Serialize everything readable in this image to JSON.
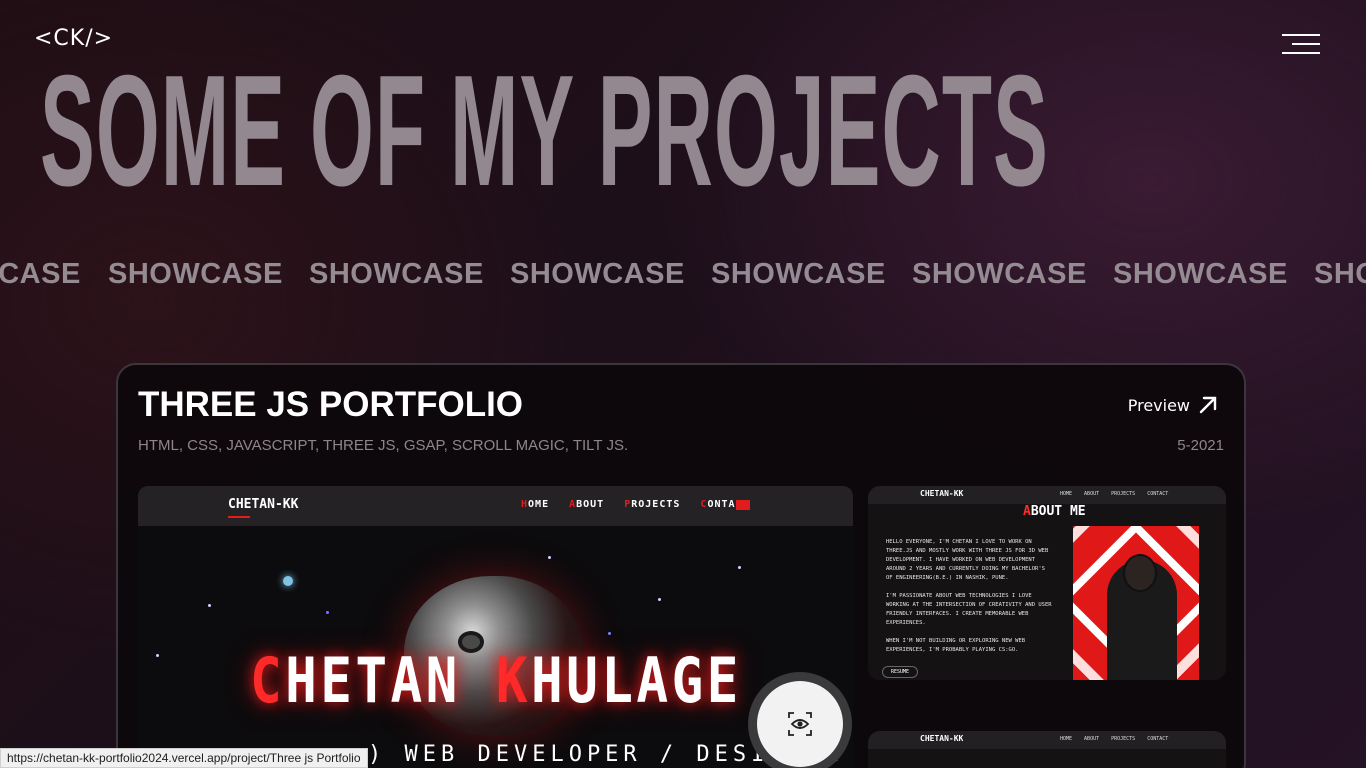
{
  "header": {
    "logo": "<CK/>",
    "menu_icon": "hamburger-menu-icon"
  },
  "hero": {
    "title": "SOME OF MY PROJECTS",
    "ticker_word": "SHOWCASE"
  },
  "project": {
    "title": "THREE JS PORTFOLIO",
    "preview_label": "Preview",
    "preview_icon": "arrow-up-right-icon",
    "tags": "HTML, CSS, JAVASCRIPT, THREE JS, GSAP, SCROLL MAGIC, TILT JS.",
    "date": "5-2021",
    "view_icon": "eye-focus-icon",
    "main_screenshot": {
      "brand": "CHETAN-KK",
      "nav": [
        "HOME",
        "ABOUT",
        "PROJECTS",
        "CONTACT"
      ],
      "name_first": "CHETAN",
      "name_last": "KHULAGE",
      "subtitle": ") WEB DEVELOPER / DESIGNER"
    },
    "side_screenshot": {
      "brand": "CHETAN-KK",
      "nav": [
        "HOME",
        "ABOUT",
        "PROJECTS",
        "CONTACT"
      ],
      "heading_first": "A",
      "heading_rest": "BOUT ME",
      "para1": "HELLO EVERYONE, I'M CHETAN I LOVE TO WORK ON THREE.JS AND MOSTLY WORK WITH THREE JS FOR 3D WEB DEVELOPMENT. I HAVE WORKED ON WEB DEVELOPMENT AROUND 2 YEARS AND CURRENTLY DOING MY BACHELOR'S OF ENGINEERING(B.E.) IN NASHIK, PUNE.",
      "para2": "I'M PASSIONATE ABOUT WEB TECHNOLOGIES I LOVE WORKING AT THE INTERSECTION OF CREATIVITY AND USER FRIENDLY INTERFACES. I CREATE MEMORABLE WEB EXPERIENCES.",
      "para3": "WHEN I'M NOT BUILDING OR EXPLORING NEW WEB EXPERIENCES, I'M PROBABLY PLAYING CS:GO.",
      "resume_label": "RESUME"
    }
  },
  "status_bar": {
    "url": "https://chetan-kk-portfolio2024.vercel.app/project/Three js Portfolio"
  },
  "colors": {
    "accent_red": "#e21c1c",
    "title_gray": "#938890",
    "muted_text": "#8d858b"
  }
}
